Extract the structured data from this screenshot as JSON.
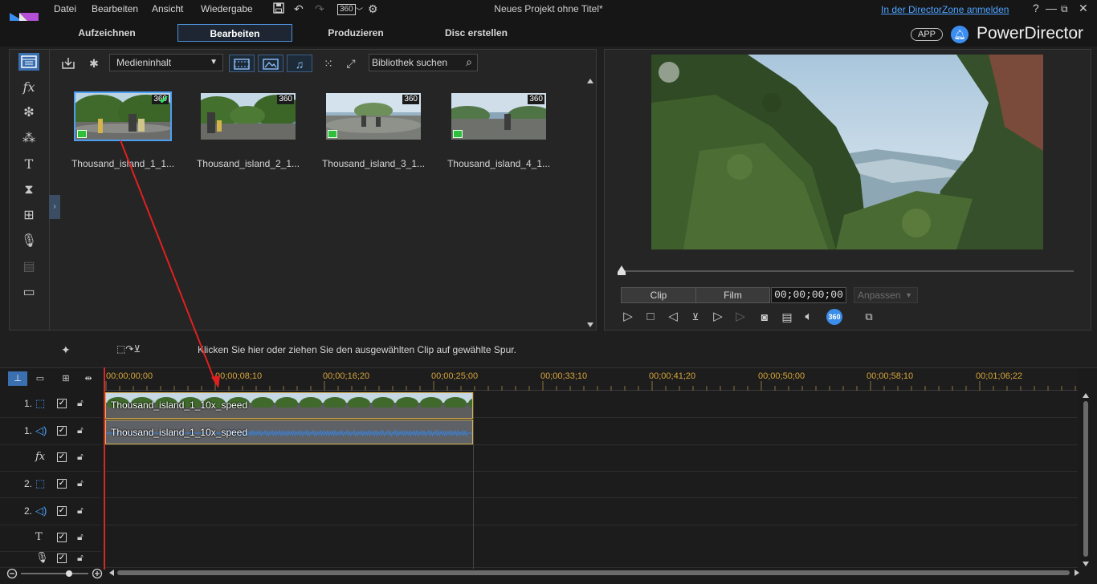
{
  "titlebar": {
    "menu": [
      "Datei",
      "Bearbeiten",
      "Ansicht",
      "Wiedergabe"
    ],
    "document_title": "Neues Projekt ohne Titel*",
    "directorzone_link": "In der DirectorZone anmelden",
    "help": "?",
    "badge_360": "360"
  },
  "modes": {
    "tabs": [
      "Aufzeichnen",
      "Bearbeiten",
      "Produzieren",
      "Disc erstellen"
    ],
    "active": "Bearbeiten",
    "app_badge": "APP",
    "brand": "PowerDirector"
  },
  "library": {
    "content_select": "Medieninhalt",
    "search_placeholder": "Bibliothek suchen",
    "items": [
      {
        "label": "Thousand_island_1_1...",
        "badge": "360",
        "selected": true
      },
      {
        "label": "Thousand_island_2_1...",
        "badge": "360",
        "selected": false
      },
      {
        "label": "Thousand_island_3_1...",
        "badge": "360",
        "selected": false
      },
      {
        "label": "Thousand_island_4_1...",
        "badge": "360",
        "selected": false
      }
    ]
  },
  "preview": {
    "clip_label": "Clip",
    "film_label": "Film",
    "timecode": "00;00;00;00",
    "fit_select": "Anpassen",
    "badge_360": "360"
  },
  "timeline_toolbar": {
    "hint": "Klicken Sie hier oder ziehen Sie den ausgewählten Clip auf gewählte Spur."
  },
  "timeline": {
    "ruler": [
      "00;00;00;00",
      "00;00;08;10",
      "00;00;16;20",
      "00;00;25;00",
      "00;00;33;10",
      "00;00;41;20",
      "00;00;50;00",
      "00;00;58;10",
      "00;01;06;22"
    ],
    "tracks": [
      {
        "label": "1.",
        "type": "video"
      },
      {
        "label": "1.",
        "type": "audio"
      },
      {
        "label": "",
        "type": "fx"
      },
      {
        "label": "2.",
        "type": "video"
      },
      {
        "label": "2.",
        "type": "audio"
      },
      {
        "label": "",
        "type": "title"
      },
      {
        "label": "",
        "type": "voice"
      }
    ],
    "video_clip_name": "Thousand_island_1_10x_speed",
    "audio_clip_name": "Thousand_island_1_10x_speed"
  },
  "colors": {
    "accent": "#3a8de8",
    "clip_border": "#d9b255",
    "playhead": "#d12828",
    "ruler_text": "#d6a53b",
    "link": "#4ea3ff"
  }
}
